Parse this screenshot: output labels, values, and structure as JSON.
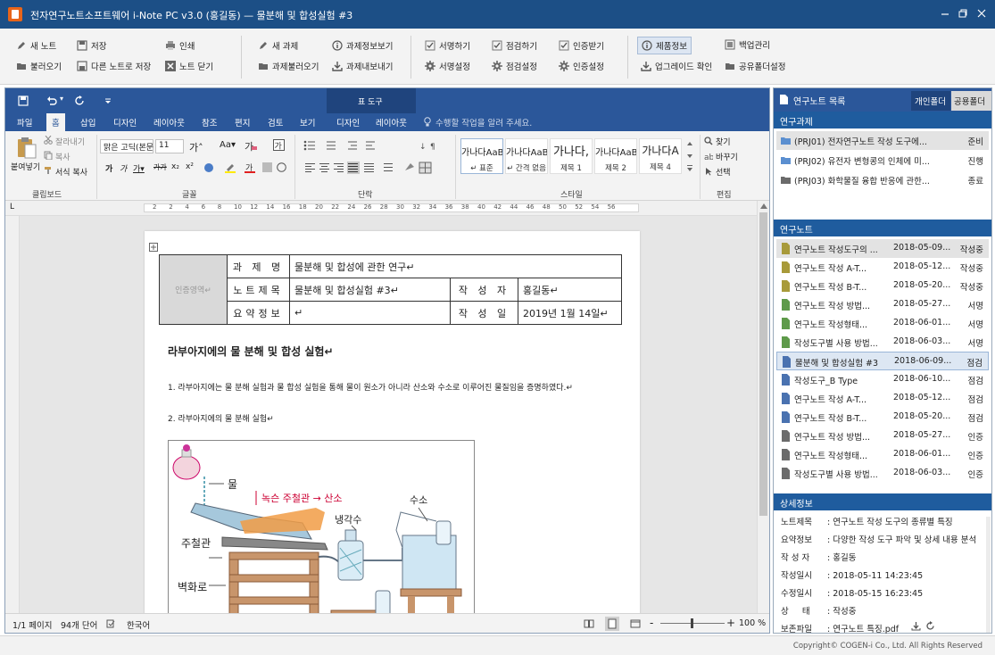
{
  "window": {
    "title": "전자연구노트소프트웨어  i-Note PC v3.0 (홍길동)  —  물분해 및 합성실험 #3"
  },
  "toolbar": {
    "new_note": "새 노트",
    "save": "저장",
    "print": "인쇄",
    "open_note": "불러오기",
    "save_as": "다른 노트로 저장",
    "close_note": "노트 닫기",
    "new_project": "새 과제",
    "project_info": "과제정보보기",
    "open_project": "과제불러오기",
    "export_project": "과제내보내기",
    "sign_request": "서명하기",
    "check_request": "점검하기",
    "cert_request": "인증받기",
    "sign_setting": "서명설정",
    "check_setting": "점검설정",
    "cert_setting": "인증설정",
    "product_info": "제품정보",
    "backup": "백업관리",
    "upgrade": "업그레이드 확인",
    "shared_folder": "공유폴더설정"
  },
  "word": {
    "qat_undo_more": "▾",
    "tabs": [
      "파일",
      "홈",
      "삽입",
      "디자인",
      "레이아웃",
      "참조",
      "편지",
      "검토",
      "보기",
      "디자인",
      "레이아웃"
    ],
    "tool_tab_group": "표 도구",
    "tell_me": "수행할 작업을 알려 주세요.",
    "clipboard": {
      "paste": "붙여넣기",
      "cut": "잘라내기",
      "copy": "복사",
      "format_painter": "서식 복사",
      "group": "클립보드"
    },
    "font": {
      "name": "맑은 고딕(본문",
      "size": "11",
      "group": "글꼴"
    },
    "paragraph": {
      "group": "단락"
    },
    "styles": {
      "group": "스타일",
      "items": [
        {
          "preview": "가나다AaB",
          "label": "↵ 표준"
        },
        {
          "preview": "가나다AaB",
          "label": "↵ 간격 없음"
        },
        {
          "preview": "가나다,",
          "label": "제목 1"
        },
        {
          "preview": "가나다AaB",
          "label": "제목 2"
        },
        {
          "preview": "가나다A",
          "label": "제목 4"
        }
      ]
    },
    "editing": {
      "find": "찾기",
      "replace": "바꾸기",
      "select": "선택",
      "group": "편집"
    },
    "ruler_ticks": [
      "2",
      "2",
      "4",
      "6",
      "8",
      "10",
      "12",
      "14",
      "16",
      "18",
      "20",
      "22",
      "24",
      "26",
      "28",
      "30",
      "32",
      "34",
      "36",
      "38",
      "40",
      "42",
      "44",
      "46",
      "48",
      "50",
      "52",
      "54",
      "56"
    ],
    "status": {
      "page": "1/1 페이지",
      "words": "94개 단어",
      "lang": "한국어",
      "zoom": "100 %",
      "zoom_minus": "-",
      "zoom_plus": "+"
    }
  },
  "document": {
    "cert_area": "인증영역↵",
    "labels": {
      "project": "과 제 명",
      "note_title": "노트제목",
      "summary": "요약정보",
      "author": "작 성 자",
      "date": "작 성 일"
    },
    "values": {
      "project": "물분해 및 합성에 관한 연구↵",
      "note_title": "물분해 및 합성실험 #3↵",
      "summary": "↵",
      "author": "홍길동↵",
      "date": "2019년 1월 14일↵"
    },
    "heading": "라부아지에의 물 분해 및 합성 실험↵",
    "para1": "1. 라부아지에는 물 분해 실험과 물 합성 실험을 통해 물이 원소가 아니라 산소와 수소로 이루어진 물질임을 증명하였다.↵",
    "para2": "2. 라부아지에의 물 분해 실험↵",
    "figure": {
      "water": "물",
      "hot_tube": "녹슨 주철관 → 산소",
      "coolant": "냉각수",
      "hydrogen": "수소",
      "iron_tube": "주철관",
      "furnace": "벽화로"
    }
  },
  "panel": {
    "title": "연구노트 목록",
    "tab_personal": "개인폴더",
    "tab_shared": "공용폴더",
    "projects_header": "연구과제",
    "projects": [
      {
        "name": "(PRJ01) 전자연구노트 작성 도구에...",
        "status": "준비"
      },
      {
        "name": "(PRJ02) 유전자 변형콩의 인체에 미...",
        "status": "진행"
      },
      {
        "name": "(PRJ03) 화학물질 융합 반응에 관한...",
        "status": "종료"
      }
    ],
    "notes_header": "연구노트",
    "notes": [
      {
        "name": "연구노트 작성도구의 ...",
        "date": "2018-05-09...",
        "status": "작성중"
      },
      {
        "name": "연구노트 작성 A-T...",
        "date": "2018-05-12...",
        "status": "작성중"
      },
      {
        "name": "연구노트 작성 B-T...",
        "date": "2018-05-20...",
        "status": "작성중"
      },
      {
        "name": "연구노트 작성 방법...",
        "date": "2018-05-27...",
        "status": "서명"
      },
      {
        "name": "연구노트 작성형태...",
        "date": "2018-06-01...",
        "status": "서명"
      },
      {
        "name": "작성도구별 사용 방법...",
        "date": "2018-06-03...",
        "status": "서명"
      },
      {
        "name": "물분해 및 합성실험 #3",
        "date": "2018-06-09...",
        "status": "점검"
      },
      {
        "name": "작성도구_B Type",
        "date": "2018-06-10...",
        "status": "점검"
      },
      {
        "name": "연구노트 작성 A-T...",
        "date": "2018-05-12...",
        "status": "점검"
      },
      {
        "name": "연구노트 작성 B-T...",
        "date": "2018-05-20...",
        "status": "점검"
      },
      {
        "name": "연구노트 작성 방법...",
        "date": "2018-05-27...",
        "status": "인증"
      },
      {
        "name": "연구노트 작성형태...",
        "date": "2018-06-01...",
        "status": "인증"
      },
      {
        "name": "작성도구별 사용 방법...",
        "date": "2018-06-03...",
        "status": "인증"
      }
    ],
    "detail_header": "상세정보",
    "details": [
      {
        "label": "노트제목",
        "value": "연구노트 작성 도구의 종류별 특징"
      },
      {
        "label": "요약정보",
        "value": "다양한 작성 도구 파악 및 상세 내용 분석"
      },
      {
        "label": "작 성 자",
        "value": "홍길동"
      },
      {
        "label": "작성일시",
        "value": "2018-05-11  14:23:45"
      },
      {
        "label": "수정일시",
        "value": "2018-05-15  16:23:45"
      },
      {
        "label": "상     태",
        "value": "작성중"
      },
      {
        "label": "보존파일",
        "value": "연구노트 특징.pdf"
      }
    ]
  },
  "footer": {
    "copyright": "Copyright© COGEN-i  Co., Ltd.  All Rights Reserved"
  },
  "colors": {
    "title_bar": "#1c4f86",
    "word_blue": "#2b579a",
    "panel_header": "#1f5c9e"
  }
}
